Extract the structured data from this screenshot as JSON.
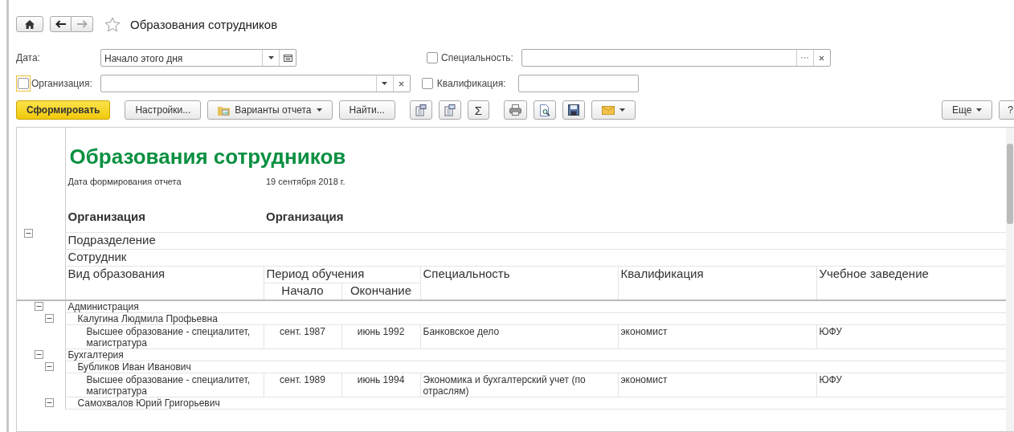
{
  "window": {
    "title": "Образования сотрудников",
    "favorite": false
  },
  "nav": {
    "back_enabled": true,
    "forward_enabled": false
  },
  "filters": {
    "date": {
      "label": "Дата:",
      "value": "Начало этого дня"
    },
    "organization": {
      "label": "Организация:",
      "checked": false,
      "focused": true
    },
    "specialty": {
      "label": "Специальность:",
      "checked": false
    },
    "qualification": {
      "label": "Квалификация:",
      "checked": false
    }
  },
  "toolbar": [
    {
      "kind": "primary",
      "label": "Сформировать"
    },
    {
      "kind": "text",
      "label": "Настройки..."
    },
    {
      "kind": "variants",
      "label": "Варианты отчета"
    },
    {
      "kind": "text",
      "label": "Найти..."
    },
    {
      "kind": "expand"
    },
    {
      "kind": "collapse"
    },
    {
      "kind": "text",
      "label": "Σ"
    },
    {
      "kind": "print"
    },
    {
      "kind": "preview"
    },
    {
      "kind": "save"
    },
    {
      "kind": "mail"
    }
  ],
  "toolbar_right": [
    {
      "kind": "menu",
      "label": "Еще"
    },
    {
      "kind": "text",
      "label": "?"
    }
  ],
  "report": {
    "title": "Образования сотрудников",
    "date_label": "Дата формирования отчета",
    "date_value": "19 сентября 2018 г.",
    "group_labels": [
      "Организация",
      "Организация"
    ],
    "levels": [
      "Подразделение",
      "Сотрудник"
    ],
    "columns": {
      "type": "Вид образования",
      "period": "Период обучения",
      "start": "Начало",
      "end": "Окончание",
      "specialty": "Специальность",
      "qualification": "Квалификация",
      "institution": "Учебное заведение"
    },
    "header_expanded": true,
    "departments": [
      {
        "name": "Администрация",
        "expanded": true,
        "employees": [
          {
            "name": "Калугина Людмила Профьевна",
            "expanded": true,
            "education": [
              {
                "type": "Высшее образование - специалитет, магистратура",
                "start": "сент. 1987",
                "end": "июнь 1992",
                "specialty": "Банковское дело",
                "qualification": "экономист",
                "institution": "ЮФУ"
              }
            ]
          }
        ]
      },
      {
        "name": "Бухгалтерия",
        "expanded": true,
        "employees": [
          {
            "name": "Бубликов Иван Иванович",
            "expanded": true,
            "education": [
              {
                "type": "Высшее образование - специалитет, магистратура",
                "start": "сент. 1989",
                "end": "июнь 1994",
                "specialty": "Экономика и бухгалтерский учет (по отраслям)",
                "qualification": "экономист",
                "institution": "ЮФУ"
              }
            ]
          },
          {
            "name": "Самохвалов Юрий Григорьевич",
            "expanded": true
          }
        ]
      }
    ]
  }
}
